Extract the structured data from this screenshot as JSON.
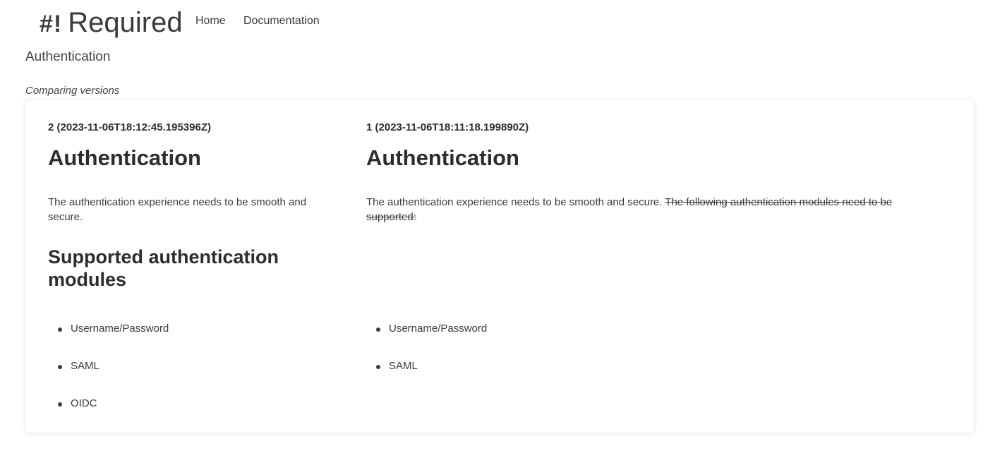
{
  "nav": {
    "brand_mark": "#!",
    "brand_name": "Required",
    "links": [
      {
        "label": "Home"
      },
      {
        "label": "Documentation"
      }
    ]
  },
  "page": {
    "title": "Authentication",
    "subtitle": "Comparing versions"
  },
  "versions": [
    {
      "label": "2 (2023-11-06T18:12:45.195396Z)",
      "heading": "Authentication",
      "paragraph": "The authentication experience needs to be smooth and secure.",
      "subheading": "Supported authentication modules",
      "items": [
        "Username/Password",
        "SAML",
        "OIDC"
      ]
    },
    {
      "label": "1 (2023-11-06T18:11:18.199890Z)",
      "heading": "Authentication",
      "paragraph": "The authentication experience needs to be smooth and secure.",
      "paragraph_removed": "The following authentication modules need to be supported:",
      "items": [
        "Username/Password",
        "SAML"
      ]
    }
  ]
}
